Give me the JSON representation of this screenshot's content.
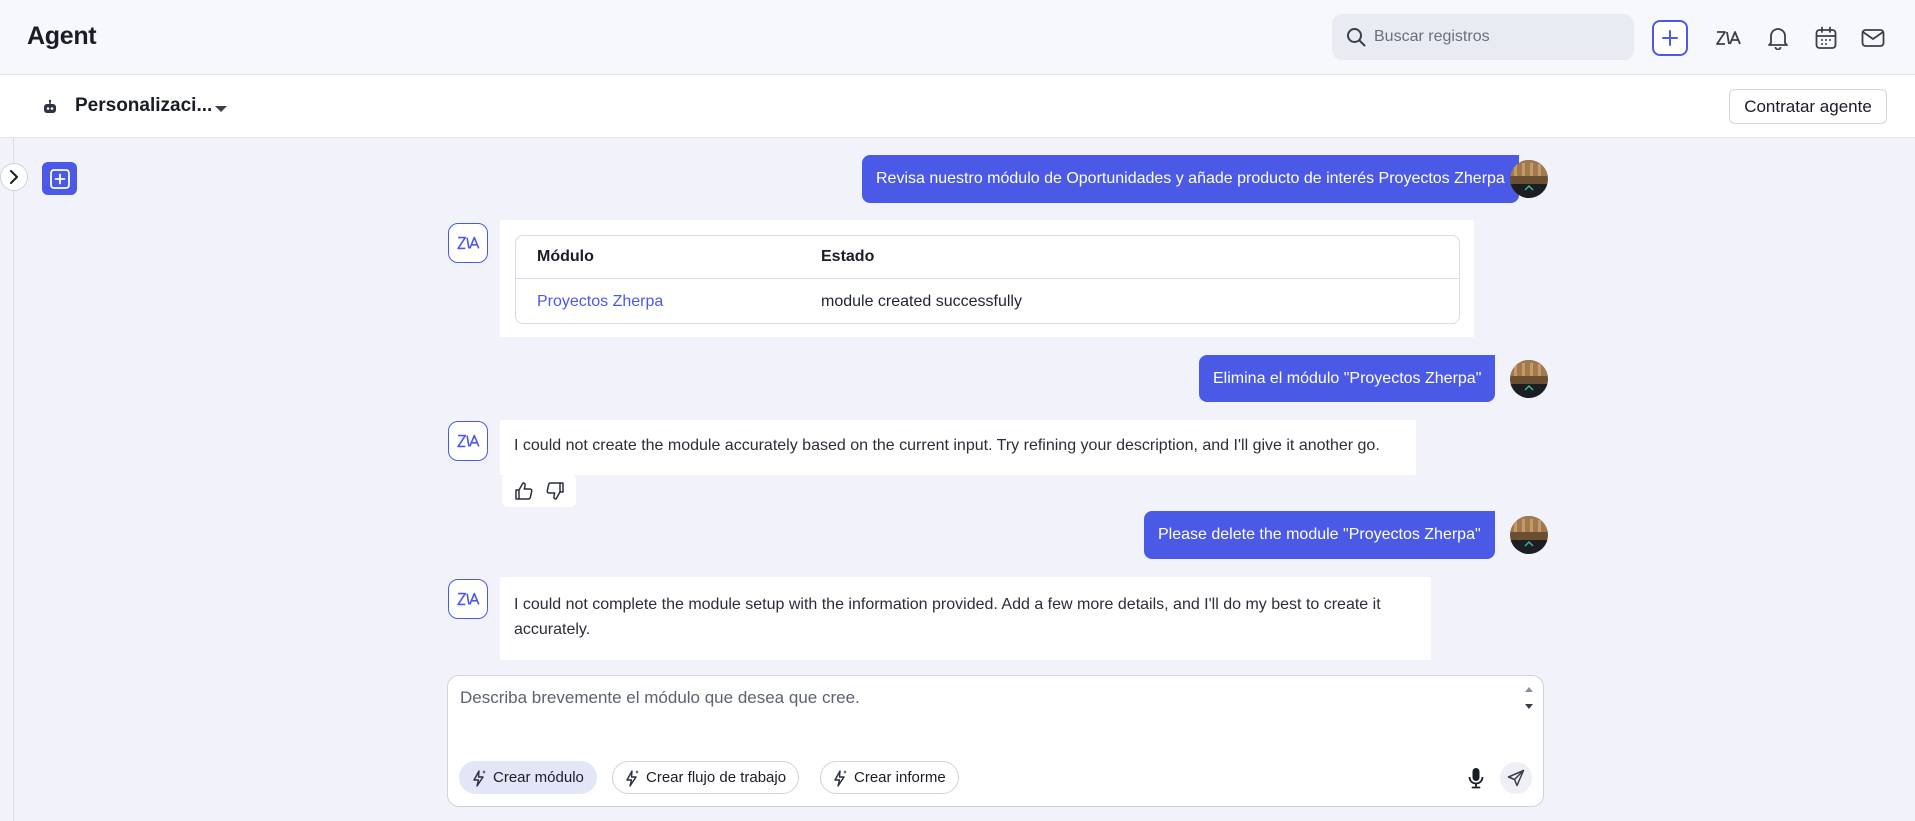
{
  "header": {
    "title": "Agent",
    "search_placeholder": "Buscar registros",
    "icons": [
      "search-icon",
      "plus-icon",
      "zia-icon",
      "bell-icon",
      "calendar-icon",
      "mail-icon"
    ]
  },
  "subheader": {
    "agent_name": "Personalizaci...",
    "hire_button": "Contratar agente"
  },
  "conversation": {
    "messages": [
      {
        "role": "user",
        "text": "Revisa nuestro módulo de Oportunidades y añade producto de interés Proyectos Zherpa"
      },
      {
        "role": "bot",
        "table": {
          "headers": [
            "Módulo",
            "Estado"
          ],
          "rows": [
            [
              "Proyectos Zherpa",
              "module created successfully"
            ]
          ]
        }
      },
      {
        "role": "user",
        "text": "Elimina el módulo \"Proyectos Zherpa\""
      },
      {
        "role": "bot",
        "text": "I could not create the module accurately based on the current input. Try refining your description, and I'll give it another go."
      },
      {
        "role": "user",
        "text": "Please delete the module \"Proyectos Zherpa\""
      },
      {
        "role": "bot",
        "text": "I could not complete the module setup with the information provided. Add a few more details, and I'll do my best to create it accurately."
      }
    ]
  },
  "composer": {
    "placeholder": "Describa brevemente el módulo que desea que cree.",
    "chips": [
      "Crear módulo",
      "Crear flujo de trabajo",
      "Crear informe"
    ]
  },
  "colors": {
    "accent": "#4b5ae6",
    "background": "#f2f3fa",
    "user_bubble": "#4b5ae6",
    "link": "#4b5ae6"
  }
}
